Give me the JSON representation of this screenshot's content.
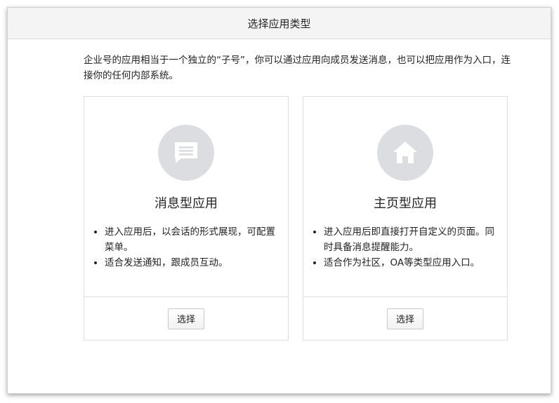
{
  "dialog": {
    "title": "选择应用类型",
    "intro": "企业号的应用相当于一个独立的“子号”，你可以通过应用向成员发送消息，也可以把应用作为入口，连接你的任何内部系统。"
  },
  "cards": [
    {
      "icon": "message-icon",
      "title": "消息型应用",
      "bullets": [
        "进入应用后，以会话的形式展现，可配置菜单。",
        "适合发送通知，跟成员互动。"
      ],
      "button_label": "选择"
    },
    {
      "icon": "home-icon",
      "title": "主页型应用",
      "bullets": [
        "进入应用后即直接打开自定义的页面。同时具备消息提醒能力。",
        "适合作为社区，OA等类型应用入口。"
      ],
      "button_label": "选择"
    }
  ],
  "colors": {
    "icon_circle": "#dcdde0",
    "header_bg": "#f4f4f4",
    "border": "#dedede"
  }
}
